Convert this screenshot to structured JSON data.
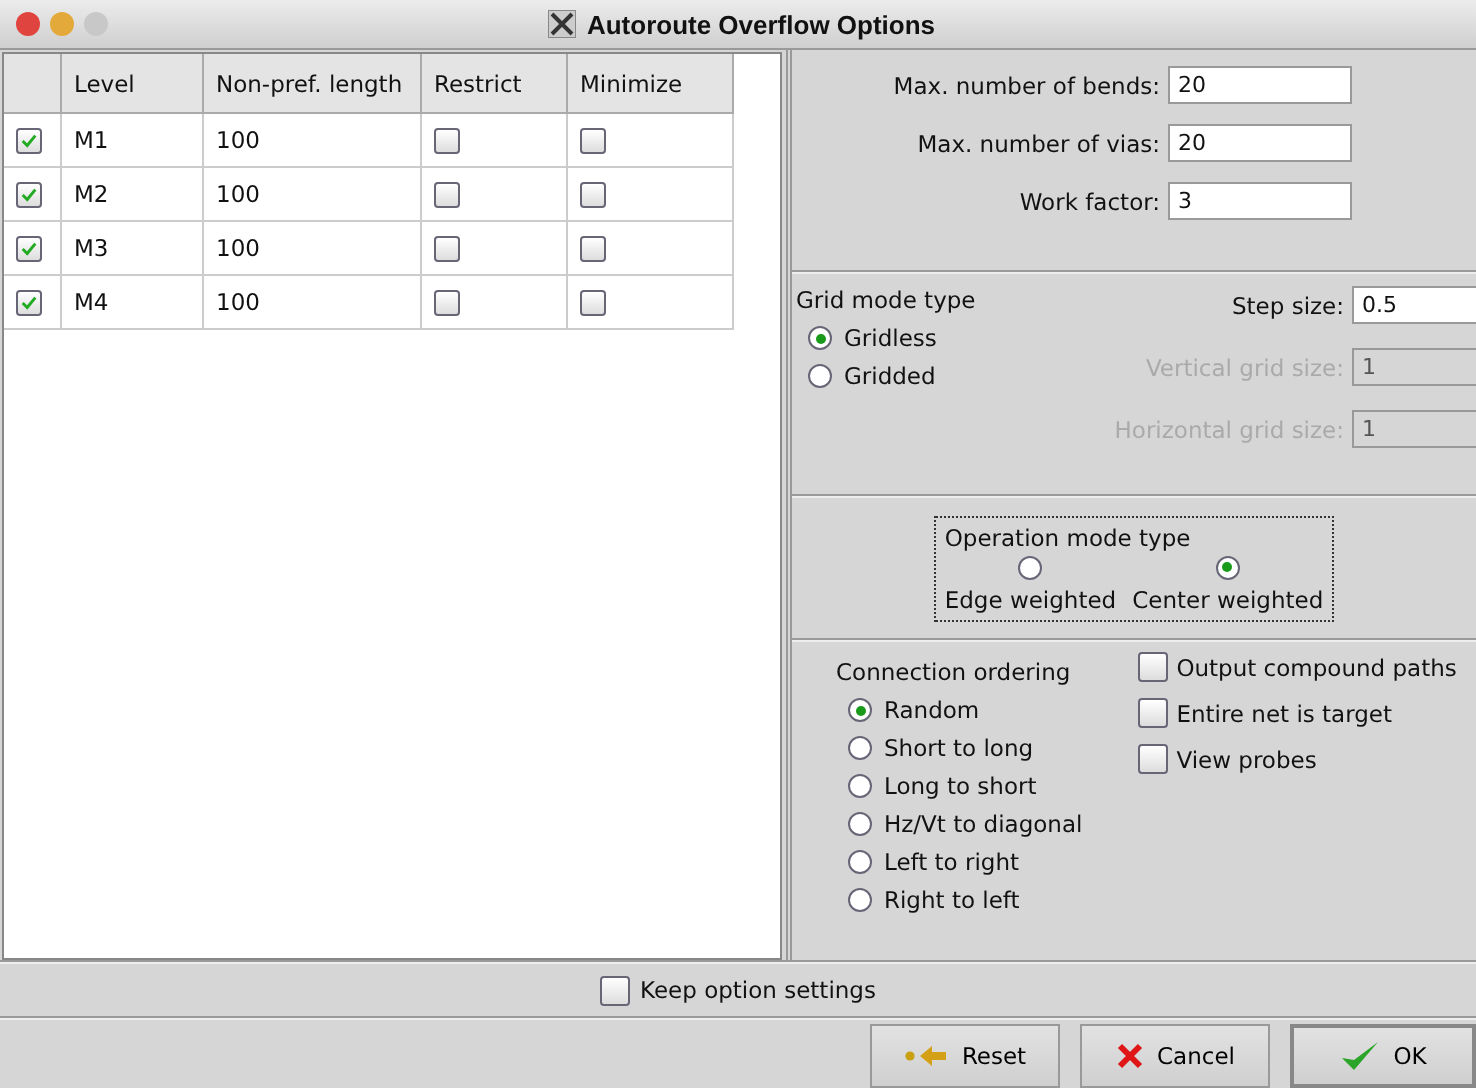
{
  "window": {
    "title": "Autoroute Overflow Options"
  },
  "table": {
    "columns": [
      "Level",
      "Non-pref. length",
      "Restrict",
      "Minimize"
    ],
    "rows": [
      {
        "enabled": true,
        "level": "M1",
        "length": "100",
        "restrict": false,
        "minimize": false
      },
      {
        "enabled": true,
        "level": "M2",
        "length": "100",
        "restrict": false,
        "minimize": false
      },
      {
        "enabled": true,
        "level": "M3",
        "length": "100",
        "restrict": false,
        "minimize": false
      },
      {
        "enabled": true,
        "level": "M4",
        "length": "100",
        "restrict": false,
        "minimize": false
      }
    ]
  },
  "limits": [
    {
      "label": "Max. number of bends:",
      "value": "20"
    },
    {
      "label": "Max. number of vias:",
      "value": "20"
    },
    {
      "label": "Work factor:",
      "value": "3"
    }
  ],
  "grid_mode": {
    "title": "Grid mode type",
    "options": [
      {
        "label": "Gridless",
        "selected": true
      },
      {
        "label": "Gridded",
        "selected": false
      }
    ],
    "sizes": [
      {
        "label": "Step size:",
        "value": "0.5",
        "disabled": false
      },
      {
        "label": "Vertical grid size:",
        "value": "1",
        "disabled": true
      },
      {
        "label": "Horizontal grid size:",
        "value": "1",
        "disabled": true
      }
    ]
  },
  "operation_mode": {
    "title": "Operation mode type",
    "options": [
      {
        "label": "Edge weighted",
        "selected": false
      },
      {
        "label": "Center weighted",
        "selected": true
      }
    ]
  },
  "connection_ordering": {
    "title": "Connection ordering",
    "options": [
      {
        "label": "Random",
        "selected": true
      },
      {
        "label": "Short to long",
        "selected": false
      },
      {
        "label": "Long to short",
        "selected": false
      },
      {
        "label": "Hz/Vt to diagonal",
        "selected": false
      },
      {
        "label": "Left to right",
        "selected": false
      },
      {
        "label": "Right to left",
        "selected": false
      }
    ]
  },
  "flags": [
    {
      "label": "Output compound paths",
      "checked": false
    },
    {
      "label": "Entire net is target",
      "checked": false
    },
    {
      "label": "View probes",
      "checked": false
    }
  ],
  "keep_settings": {
    "label": "Keep option settings",
    "checked": false
  },
  "buttons": [
    {
      "kind": "reset",
      "label": "Reset"
    },
    {
      "kind": "cancel",
      "label": "Cancel"
    },
    {
      "kind": "ok",
      "label": "OK"
    }
  ]
}
